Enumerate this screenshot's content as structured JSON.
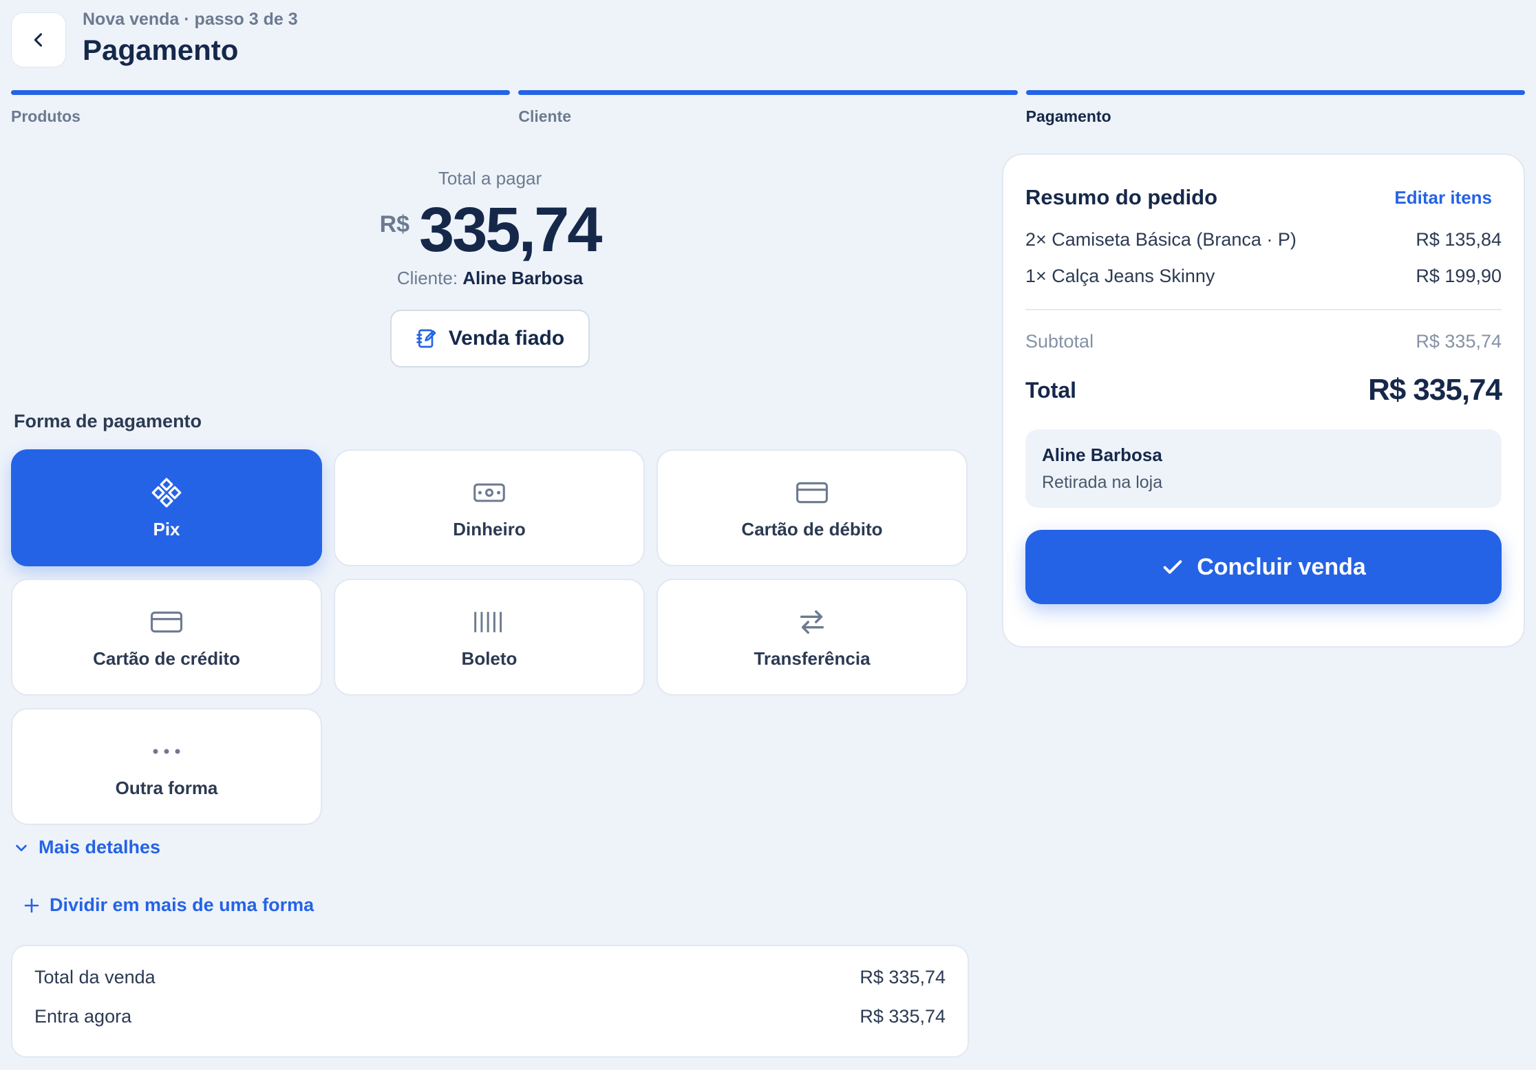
{
  "header": {
    "step_label": "Nova venda · passo 3 de 3",
    "title": "Pagamento",
    "back_icon": "chevron-left-icon"
  },
  "steps": [
    {
      "label": "Produtos",
      "completed": true,
      "active": false
    },
    {
      "label": "Cliente",
      "completed": true,
      "active": false
    },
    {
      "label": "Pagamento",
      "completed": true,
      "active": true
    }
  ],
  "total": {
    "label": "Total a pagar",
    "currency": "R$",
    "value": "335,74",
    "client_prefix": "Cliente:",
    "client_name": "Aline Barbosa",
    "fiado_label": "Venda fiado"
  },
  "payment": {
    "section_label": "Forma de pagamento",
    "selected": "Pix",
    "methods": [
      {
        "label": "Pix",
        "icon": "pix-icon"
      },
      {
        "label": "Dinheiro",
        "icon": "cash-icon"
      },
      {
        "label": "Cartão de débito",
        "icon": "card-icon"
      },
      {
        "label": "Cartão de crédito",
        "icon": "card-icon"
      },
      {
        "label": "Boleto",
        "icon": "barcode-icon"
      },
      {
        "label": "Transferência",
        "icon": "transfer-icon"
      },
      {
        "label": "Outra forma",
        "icon": "more-icon"
      }
    ],
    "more_details": "Mais detalhes",
    "split": "Dividir em mais de uma forma"
  },
  "sale_summary": {
    "rows": [
      {
        "label": "Total da venda",
        "value": "R$ 335,74"
      },
      {
        "label": "Entra agora",
        "value": "R$ 335,74"
      }
    ]
  },
  "order": {
    "title": "Resumo do pedido",
    "edit_label": "Editar itens",
    "items": [
      {
        "desc": "2× Camiseta Básica (Branca · P)",
        "price": "R$ 135,84"
      },
      {
        "desc": "1× Calça Jeans Skinny",
        "price": "R$ 199,90"
      }
    ],
    "subtotal_label": "Subtotal",
    "subtotal_value": "R$ 335,74",
    "total_label": "Total",
    "total_value": "R$ 335,74",
    "customer_name": "Aline Barbosa",
    "customer_note": "Retirada na loja",
    "conclude_label": "Concluir venda"
  },
  "colors": {
    "accent": "#2563e6",
    "background": "#eef3fa",
    "text_dark": "#16284a",
    "text_muted": "#6c7a8f"
  }
}
